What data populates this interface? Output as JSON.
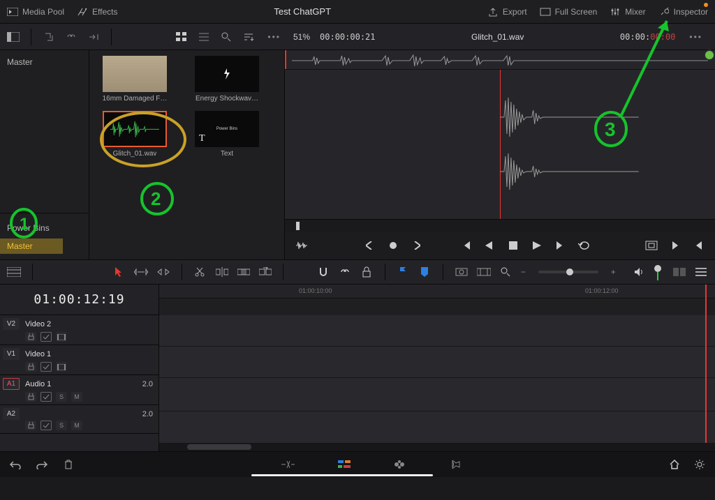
{
  "topbar": {
    "media_pool": "Media Pool",
    "effects": "Effects",
    "project_title": "Test ChatGPT",
    "export": "Export",
    "full_screen": "Full Screen",
    "mixer": "Mixer",
    "inspector": "Inspector"
  },
  "toolbar2": {
    "zoom_pct": "51%",
    "timecode": "00:00:00:21",
    "clip_name": "Glitch_01.wav",
    "tc_right_main": "00:00:",
    "tc_right_red": "00:00"
  },
  "bins": {
    "master": "Master",
    "power_bins": "Power Bins",
    "power_master": "Master"
  },
  "pool": {
    "items": [
      {
        "label": "16mm Damaged F…",
        "kind": "film"
      },
      {
        "label": "Energy Shockwav…",
        "kind": "shock"
      },
      {
        "label": "Glitch_01.wav",
        "kind": "audio"
      },
      {
        "label": "Text",
        "kind": "text",
        "caption": "Power Bins",
        "T": "T"
      }
    ]
  },
  "timeline": {
    "main_tc": "01:00:12:19",
    "ruler": {
      "t1": "01:00:10:00",
      "t2": "01:00:12:00"
    },
    "tracks": [
      {
        "badge": "V2",
        "name": "Video 2",
        "val": ""
      },
      {
        "badge": "V1",
        "name": "Video 1",
        "val": ""
      },
      {
        "badge": "A1",
        "name": "Audio 1",
        "val": "2.0",
        "selected": true,
        "sm": true
      },
      {
        "badge": "A2",
        "name": "",
        "val": "2.0",
        "sm": true
      }
    ],
    "icons": {
      "lock": "🔒",
      "auto": "⟲",
      "S": "S",
      "M": "M"
    }
  },
  "annotations": {
    "one": "1",
    "two": "2",
    "three": "3"
  }
}
